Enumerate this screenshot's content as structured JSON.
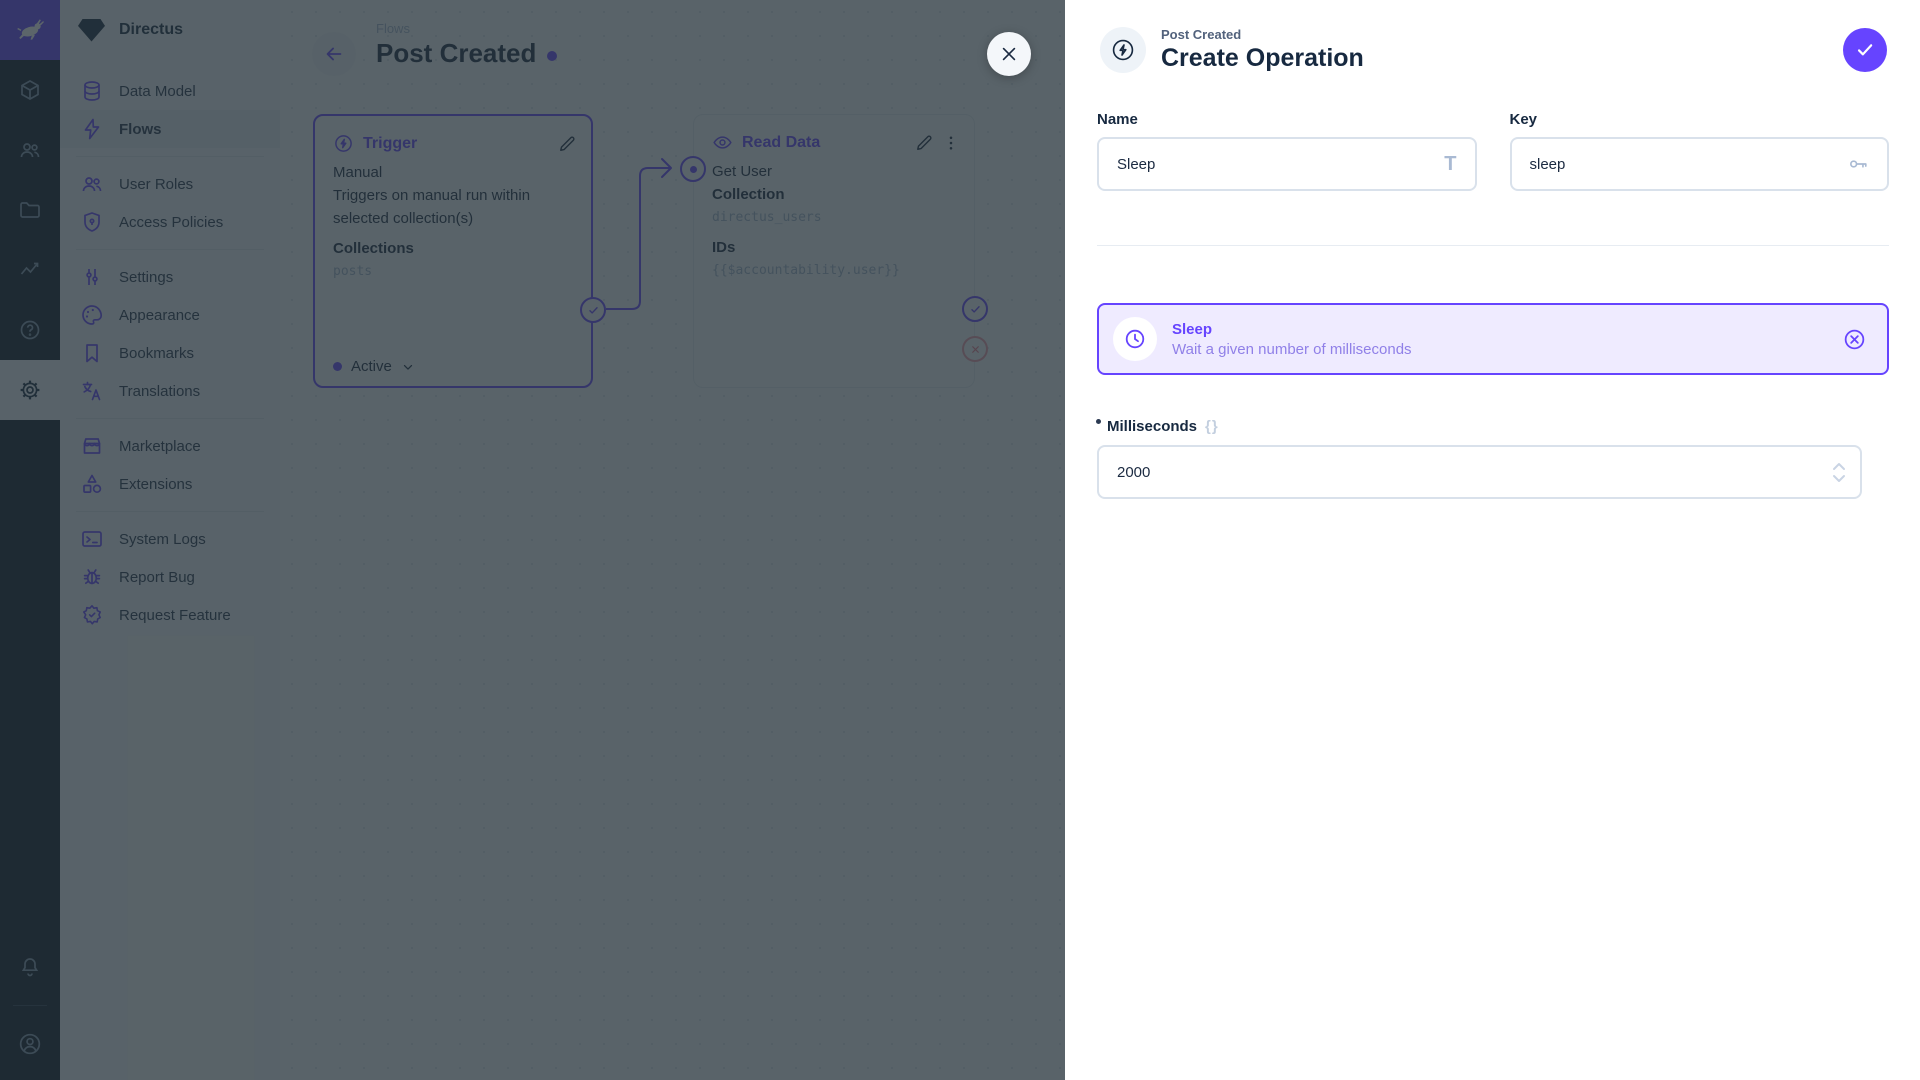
{
  "colors": {
    "accent": "#6644FF",
    "danger": "#E35169",
    "dark": "#172940",
    "subdued": "#A2B5CD"
  },
  "project": {
    "name": "Directus"
  },
  "sidebar": {
    "items": [
      {
        "label": "Data Model"
      },
      {
        "label": "Flows"
      },
      {
        "label": "User Roles"
      },
      {
        "label": "Access Policies"
      },
      {
        "label": "Settings"
      },
      {
        "label": "Appearance"
      },
      {
        "label": "Bookmarks"
      },
      {
        "label": "Translations"
      },
      {
        "label": "Marketplace"
      },
      {
        "label": "Extensions"
      },
      {
        "label": "System Logs"
      },
      {
        "label": "Report Bug"
      },
      {
        "label": "Request Feature"
      }
    ]
  },
  "canvas": {
    "breadcrumb": "Flows",
    "title": "Post Created",
    "trigger": {
      "header": "Trigger",
      "type": "Manual",
      "description": "Triggers on manual run within selected collection(s)",
      "collections_label": "Collections",
      "collections_value": "posts",
      "status": "Active"
    },
    "read": {
      "header": "Read Data",
      "name": "Get User",
      "collection_label": "Collection",
      "collection_value": "directus_users",
      "ids_label": "IDs",
      "ids_value": "{{$accountability.user}}"
    }
  },
  "drawer": {
    "breadcrumb": "Post Created",
    "title": "Create Operation",
    "name_label": "Name",
    "name_value": "Sleep",
    "key_label": "Key",
    "key_value": "sleep",
    "operation": {
      "title": "Sleep",
      "description": "Wait a given number of milliseconds"
    },
    "milliseconds_label": "Milliseconds",
    "milliseconds_value": "2000"
  },
  "icons": {
    "title_glyph": "T",
    "raw_glyph": "{}"
  }
}
